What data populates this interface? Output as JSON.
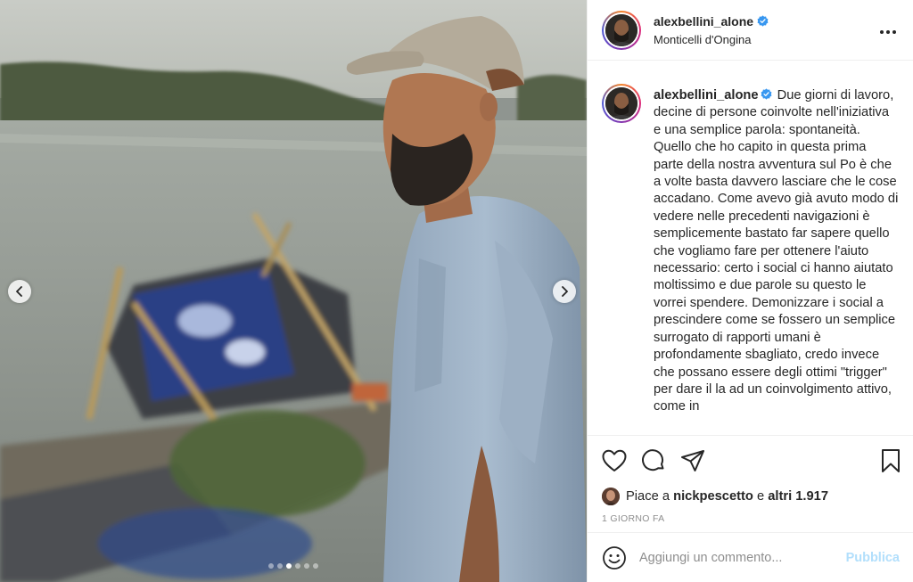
{
  "post": {
    "username": "alexbellini_alone",
    "location": "Monticelli d'Ongina",
    "more_icon": "more-horizontal-icon",
    "verified_icon": "verified-badge-icon"
  },
  "photo": {
    "prev_icon": "chevron-left-icon",
    "next_icon": "chevron-right-icon",
    "slide_count": 6,
    "active_slide": 3
  },
  "caption": {
    "username": "alexbellini_alone",
    "text": "Due giorni di lavoro, decine di persone coinvolte nell'iniziativa e una semplice parola: spontaneità. Quello che ho capito in questa prima parte della nostra avventura sul Po è che a volte basta davvero lasciare che le cose accadano. Come avevo già avuto modo di vedere nelle precedenti navigazioni è semplicemente bastato far sapere quello che vogliamo fare per ottenere l'aiuto necessario: certo i social ci hanno aiutato moltissimo e due parole su questo le vorrei spendere. Demonizzare i social a prescindere come se fossero un semplice surrogato di rapporti umani è profondamente sbagliato, credo invece che possano essere degli ottimi \"trigger\" per dare il la ad un coinvolgimento attivo, come in"
  },
  "actions": {
    "like_icon": "heart-icon",
    "comment_icon": "comment-icon",
    "share_icon": "share-icon",
    "save_icon": "bookmark-icon"
  },
  "likes": {
    "prefix": "Piace a",
    "user": "nickpescetto",
    "connector": "e",
    "others": "altri 1.917"
  },
  "timestamp": "1 GIORNO FA",
  "comment": {
    "placeholder": "Aggiungi un commento...",
    "publish_label": "Pubblica",
    "emoji_icon": "emoji-icon"
  },
  "colors": {
    "text": "#262626",
    "secondary": "#8e8e8e",
    "verified": "#3897f0",
    "publish_disabled": "#b2dffc",
    "border": "#efefef"
  }
}
